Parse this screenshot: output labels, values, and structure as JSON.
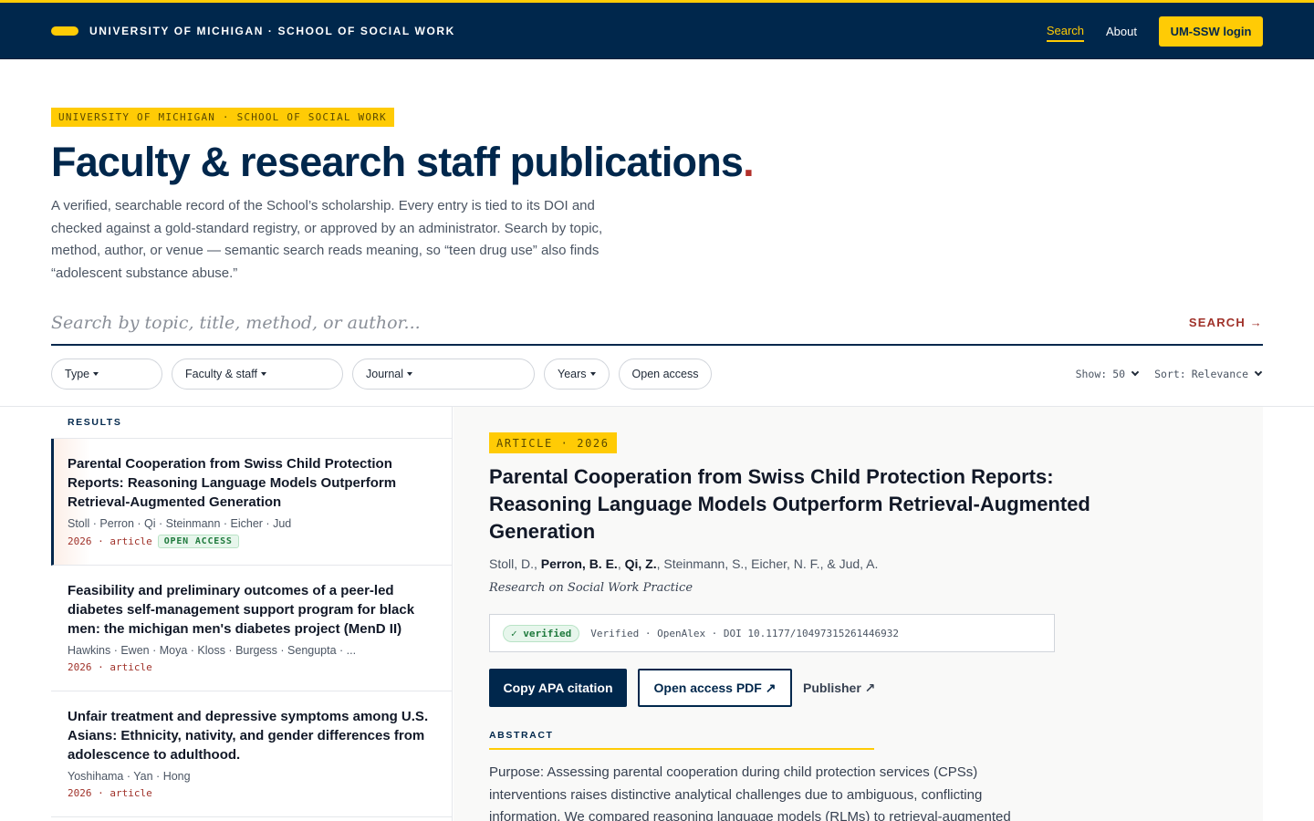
{
  "header": {
    "brand": "UNIVERSITY OF MICHIGAN · SCHOOL OF SOCIAL WORK",
    "nav": [
      {
        "label": "Search",
        "active": true
      },
      {
        "label": "About",
        "active": false
      }
    ],
    "login_label": "UM-SSW login"
  },
  "hero": {
    "eyebrow": "UNIVERSITY OF MICHIGAN · SCHOOL OF SOCIAL WORK",
    "title": "Faculty & research staff publications",
    "title_dot": ".",
    "intro": "A verified, searchable record of the School’s scholarship. Every entry is tied to its DOI and checked against a gold-standard registry, or approved by an administrator. Search by topic, method, author, or venue — semantic search reads meaning, so “teen drug use” also finds “adolescent substance abuse.”"
  },
  "search": {
    "placeholder": "Search by topic, title, method, or author...",
    "button_label": "SEARCH →"
  },
  "filters": {
    "type": "Type",
    "faculty": "Faculty & staff",
    "journal": "Journal",
    "years": "Years",
    "open_access": "Open access"
  },
  "controls": {
    "show_label": "Show:",
    "show_value": "50",
    "sort_label": "Sort:",
    "sort_value": "Relevance"
  },
  "results": {
    "label": "RESULTS",
    "items": [
      {
        "title": "Parental Cooperation from Swiss Child Protection Reports: Reasoning Language Models Outperform Retrieval-Augmented Generation",
        "authors": "Stoll · Perron · Qi · Steinmann · Eicher · Jud",
        "meta": "2026 · article",
        "badge": "OPEN ACCESS"
      },
      {
        "title": "Feasibility and preliminary outcomes of a peer-led diabetes self-management support program for black men: the michigan men's diabetes project (MenD II)",
        "authors": "Hawkins · Ewen · Moya · Kloss · Burgess · Sengupta · ...",
        "meta": "2026 · article",
        "badge": ""
      },
      {
        "title": "Unfair treatment and depressive symptoms among U.S. Asians: Ethnicity, nativity, and gender differences from adolescence to adulthood.",
        "authors": "Yoshihama · Yan · Hong",
        "meta": "2026 · article",
        "badge": ""
      }
    ]
  },
  "detail": {
    "tag": "ARTICLE · 2026",
    "title": "Parental Cooperation from Swiss Child Protection Reports: Reasoning Language Models Outperform Retrieval-Augmented Generation",
    "authors": {
      "a1": "Stoll, D., ",
      "a2": "Perron, B. E.",
      "a3": ", ",
      "a4": "Qi, Z.",
      "a5": ", Steinmann, S., Eicher, N. F., & Jud, A."
    },
    "journal": "Research on Social Work Practice",
    "verified_badge": "✓ verified",
    "verification": "Verified · OpenAlex · DOI 10.1177/10497315261446932",
    "copy_label": "Copy APA citation",
    "pdf_label": "Open access PDF ↗",
    "publisher_label": "Publisher ↗",
    "abstract_label": "ABSTRACT",
    "abstract": "Purpose: Assessing parental cooperation during child protection services (CPSs) interventions raises distinctive analytical challenges due to ambiguous, conflicting information. We compared reasoning language models (RLMs) to retrieval-augmented generation"
  },
  "colors": {
    "navy": "#00274c",
    "maize": "#ffcb05",
    "accent_red": "#a0322a",
    "verified_green": "#1f7a3d"
  }
}
